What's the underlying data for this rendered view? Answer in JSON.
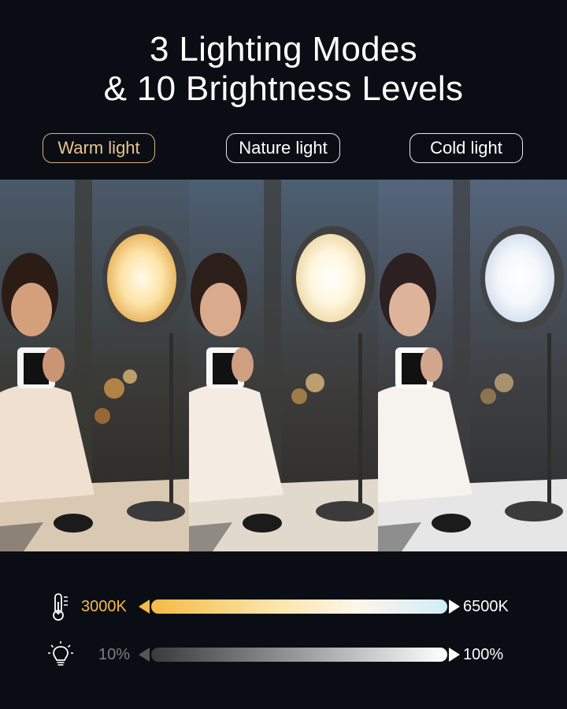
{
  "headline": {
    "line1": "3 Lighting Modes",
    "line2": "& 10 Brightness Levels"
  },
  "modes": [
    {
      "label": "Warm light",
      "color": "#e8c48e"
    },
    {
      "label": "Nature light",
      "color": "#ffffff"
    },
    {
      "label": "Cold light",
      "color": "#ffffff"
    }
  ],
  "color_temperature": {
    "icon": "thermometer-icon",
    "min_label": "3000K",
    "max_label": "6500K",
    "gradient": [
      "#f4bb46",
      "#fbe3a6",
      "#fdf6ea",
      "#cfeef7"
    ]
  },
  "brightness": {
    "icon": "lightbulb-icon",
    "min_label": "10%",
    "max_label": "100%",
    "gradient": [
      "#3a3a3a",
      "#9a9a9a",
      "#ffffff"
    ]
  }
}
